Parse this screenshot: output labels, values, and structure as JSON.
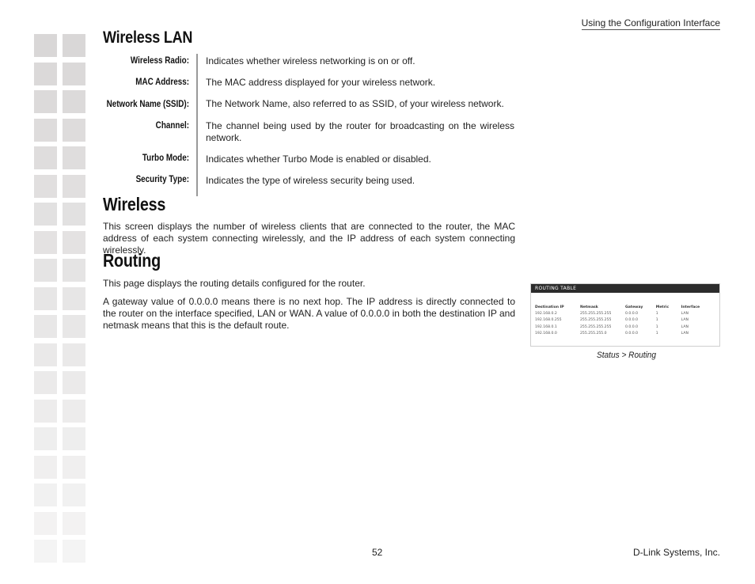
{
  "header": {
    "running_title": "Using the Configuration Interface"
  },
  "sections": {
    "wireless_lan": {
      "title": "Wireless LAN",
      "fields": [
        {
          "term": "Wireless Radio:",
          "desc": "Indicates whether wireless networking is on or off."
        },
        {
          "term": "MAC Address:",
          "desc": "The MAC address displayed for your wireless network."
        },
        {
          "term": "Network Name (SSID):",
          "desc": "The Network Name, also referred to as SSID, of your wireless network."
        },
        {
          "term": "Channel:",
          "desc": "The channel being used by the router for broadcasting on the wireless network."
        },
        {
          "term": "Turbo Mode:",
          "desc": "Indicates whether Turbo Mode is enabled or disabled."
        },
        {
          "term": "Security Type:",
          "desc": "Indicates the type of wireless security being used."
        }
      ]
    },
    "wireless": {
      "title": "Wireless",
      "body": "This screen displays the number of wireless clients that are connected to the router, the MAC address of each system connecting wirelessly, and the IP address of each system connecting wirelessly."
    },
    "routing": {
      "title": "Routing",
      "body1": "This page displays the routing details configured for the router.",
      "body2": "A gateway value of 0.0.0.0 means there is no next hop. The IP address is directly connected to the router on the interface specified, LAN or WAN. A value of 0.0.0.0 in both the destination IP and netmask means that this is the default route."
    }
  },
  "routing_table": {
    "title": "ROUTING TABLE",
    "columns": [
      "Destination IP",
      "Netmask",
      "Gateway",
      "Metric",
      "Interface"
    ],
    "rows": [
      [
        "192.168.0.2",
        "255.255.255.255",
        "0.0.0.0",
        "1",
        "LAN"
      ],
      [
        "192.168.0.255",
        "255.255.255.255",
        "0.0.0.0",
        "1",
        "LAN"
      ],
      [
        "192.168.0.1",
        "255.255.255.255",
        "0.0.0.0",
        "1",
        "LAN"
      ],
      [
        "192.168.0.0",
        "255.255.255.0",
        "0.0.0.0",
        "1",
        "LAN"
      ]
    ],
    "caption": "Status > Routing"
  },
  "footer": {
    "page_number": "52",
    "company": "D-Link Systems, Inc."
  },
  "colors": {
    "table_header_bg": "#2c2c2c",
    "decor_square_top": "#d9d7d7",
    "decor_square_bottom": "#f3f3f3"
  }
}
